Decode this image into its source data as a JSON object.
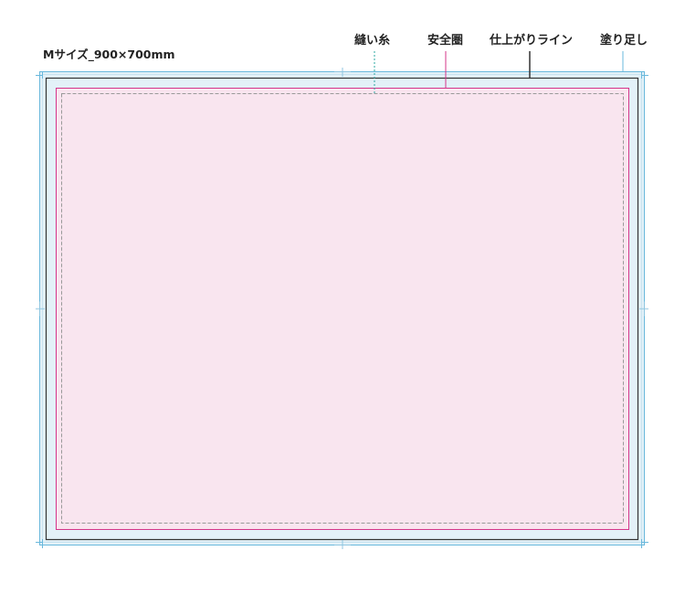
{
  "size_label": "Mサイズ_900×700mm",
  "labels": {
    "stitch": "縫い糸",
    "safe_area": "安全圏",
    "trim_line": "仕上がりライン",
    "bleed": "塗り足し"
  },
  "colors": {
    "bleed_fill": "#e3f1f8",
    "bleed_stroke": "#69b8dc",
    "trim_stroke": "#333333",
    "safe_fill": "#f9e5ef",
    "safe_stroke": "#d4358a",
    "stitch_stroke": "#9a9a9a",
    "stitch_leader": "#2aa7a0",
    "border_ring": "#c9e3ef"
  }
}
